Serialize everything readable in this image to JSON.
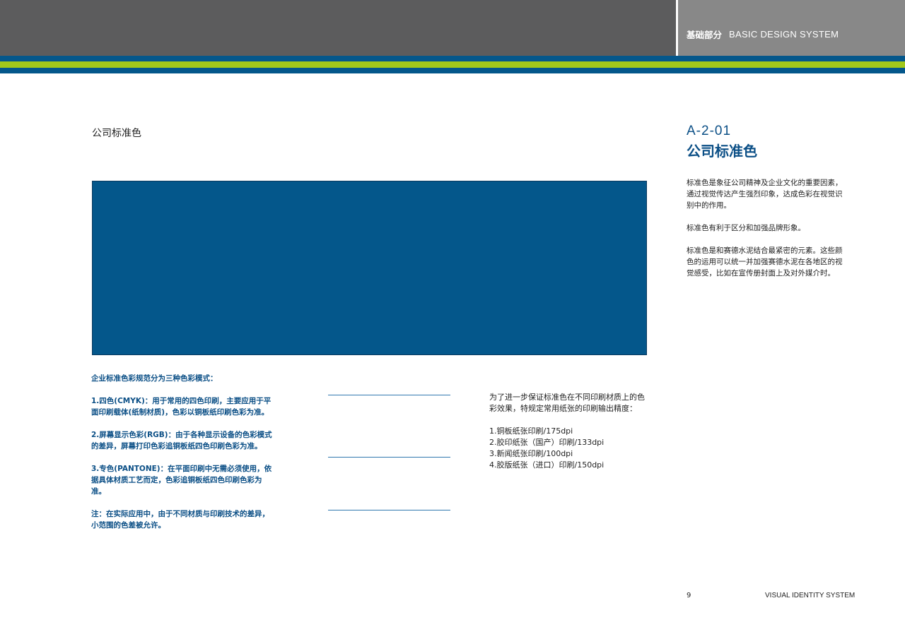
{
  "header": {
    "label_cn": "基础部分",
    "label_en": "BASIC DESIGN SYSTEM"
  },
  "colors": {
    "header_dark": "#5c5c5d",
    "header_light": "#888888",
    "stripe_blue": "#04578b",
    "stripe_green": "#a2c81a",
    "standard_color": "#04578b",
    "text_blue": "#0b4f86"
  },
  "main": {
    "section_title": "公司标准色",
    "modes": [
      "企业标准色彩规范分为三种色彩模式：",
      "1.四色(CMYK)：用于常用的四色印刷，主要应用于平面印刷载体(纸制材质)，色彩以铜板纸印刷色彩为准。",
      "2.屏幕显示色彩(RGB)：由于各种显示设备的色彩模式的差异，屏幕打印色彩追铜板纸四色印刷色彩为准。",
      "3.专色(PANTONE)：在平面印刷中无需必须使用，依据具体材质工艺而定，色彩追铜板纸四色印刷色彩为准。",
      "注：在实际应用中，由于不同材质与印刷技术的差异，小范围的色差被允许。"
    ],
    "print_intro": "为了进一步保证标准色在不同印刷材质上的色彩效果，特规定常用纸张的印刷输出精度：",
    "print_specs": [
      "1.铜板纸张印刷/175dpi",
      "2.胶印纸张（国产）印刷/133dpi",
      "3.新闻纸张印刷/100dpi",
      "4.胶版纸张（进口）印刷/150dpi"
    ]
  },
  "sidebar": {
    "code": "A-2-01",
    "title": "公司标准色",
    "paragraphs": [
      "标准色是象征公司精神及企业文化的重要因素，通过视觉传达产生强烈印象，达成色彩在视觉识别中的作用。",
      "标准色有利于区分和加强品牌形象。",
      "标准色是和赛德水泥结合最紧密的元素。这些颜色的运用可以统一并加强赛德水泥在各地区的视觉感受，比如在宣传册封面上及对外媒介时。"
    ]
  },
  "footer": {
    "page_number": "9",
    "label": "VISUAL IDENTITY SYSTEM"
  }
}
